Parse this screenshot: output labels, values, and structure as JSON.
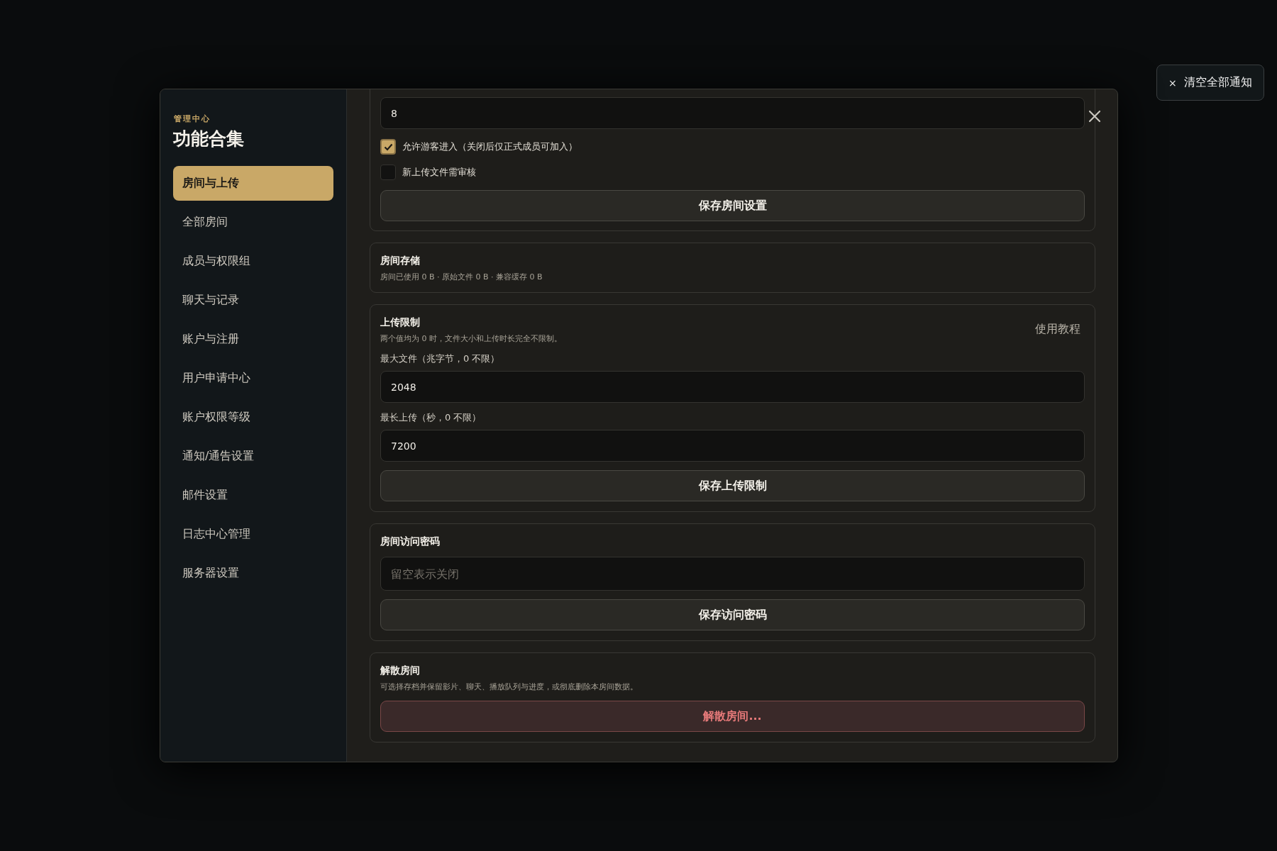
{
  "notification_button": {
    "icon": "×",
    "label": "清空全部通知"
  },
  "sidebar": {
    "eyebrow": "管理中心",
    "title": "功能合集",
    "items": [
      {
        "label": "房间与上传",
        "selected": true
      },
      {
        "label": "全部房间",
        "selected": false
      },
      {
        "label": "成员与权限组",
        "selected": false
      },
      {
        "label": "聊天与记录",
        "selected": false
      },
      {
        "label": "账户与注册",
        "selected": false
      },
      {
        "label": "用户申请中心",
        "selected": false
      },
      {
        "label": "账户权限等级",
        "selected": false
      },
      {
        "label": "通知/通告设置",
        "selected": false
      },
      {
        "label": "邮件设置",
        "selected": false
      },
      {
        "label": "日志中心管理",
        "selected": false
      },
      {
        "label": "服务器设置",
        "selected": false
      }
    ]
  },
  "sections": [
    {
      "items": [
        {
          "kind": "field",
          "value": "8"
        },
        {
          "kind": "checkbox",
          "label": "允许游客进入（关闭后仅正式成员可加入）",
          "checked": true
        },
        {
          "kind": "checkbox",
          "label": "新上传文件需审核",
          "checked": false
        },
        {
          "kind": "button",
          "label": "保存房间设置",
          "danger": false
        }
      ]
    },
    {
      "title": "房间存储",
      "description": "房间已使用 0 B · 原始文件 0 B · 兼容缓存 0 B"
    },
    {
      "title": "上传限制",
      "description": "两个值均为 0 时，文件大小和上传时长完全不限制。",
      "link": "使用教程",
      "items": [
        {
          "kind": "field",
          "label": "最大文件（兆字节，0 不限）",
          "value": "2048"
        },
        {
          "kind": "field",
          "label": "最长上传（秒，0 不限）",
          "value": "7200"
        },
        {
          "kind": "button",
          "label": "保存上传限制",
          "danger": false
        }
      ]
    },
    {
      "title": "房间访问密码",
      "items": [
        {
          "kind": "field",
          "placeholder": "留空表示关闭"
        },
        {
          "kind": "button",
          "label": "保存访问密码",
          "danger": false
        }
      ]
    },
    {
      "title": "解散房间",
      "description": "可选择存档并保留影片、聊天、播放队列与进度，或彻底删除本房间数据。",
      "items": [
        {
          "kind": "button",
          "label": "解散房间...",
          "danger": true
        }
      ]
    }
  ]
}
